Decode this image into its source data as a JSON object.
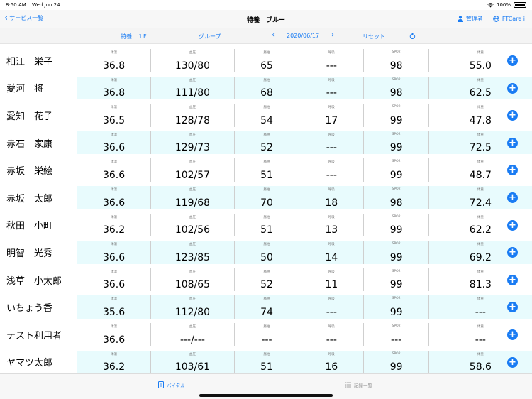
{
  "status": {
    "time": "8:50 AM",
    "date": "Wed Jun 24",
    "battery": "100%"
  },
  "nav": {
    "back_label": "サービス一覧",
    "title": "特養　ブルー",
    "admin_label": "管理者",
    "app_label": "FTCare i"
  },
  "filter": {
    "floor": "特養　１F",
    "group": "グループ",
    "date": "2020/06/17",
    "reset": "リセット"
  },
  "columns": [
    "体温",
    "血圧",
    "脈拍",
    "呼吸",
    "SPO2",
    "体重"
  ],
  "rows": [
    {
      "name": "相江　栄子",
      "values": [
        "36.8",
        "130/80",
        "65",
        "---",
        "98",
        "55.0"
      ]
    },
    {
      "name": "愛河　将",
      "values": [
        "36.8",
        "111/80",
        "68",
        "---",
        "98",
        "62.5"
      ]
    },
    {
      "name": "愛知　花子",
      "values": [
        "36.5",
        "128/78",
        "54",
        "17",
        "99",
        "47.8"
      ]
    },
    {
      "name": "赤石　家康",
      "values": [
        "36.6",
        "129/73",
        "52",
        "---",
        "99",
        "72.5"
      ]
    },
    {
      "name": "赤坂　栄絵",
      "values": [
        "36.6",
        "102/57",
        "51",
        "---",
        "99",
        "48.7"
      ]
    },
    {
      "name": "赤坂　太郎",
      "values": [
        "36.6",
        "119/68",
        "70",
        "18",
        "98",
        "72.4"
      ]
    },
    {
      "name": "秋田　小町",
      "values": [
        "36.2",
        "102/56",
        "51",
        "13",
        "99",
        "62.2"
      ]
    },
    {
      "name": "明智　光秀",
      "values": [
        "36.6",
        "123/85",
        "50",
        "14",
        "99",
        "69.2"
      ]
    },
    {
      "name": "浅草　小太郎",
      "values": [
        "36.6",
        "108/65",
        "52",
        "11",
        "99",
        "81.3"
      ]
    },
    {
      "name": "いちょう香",
      "values": [
        "35.6",
        "112/80",
        "74",
        "---",
        "99",
        "---"
      ]
    },
    {
      "name": "テスト利用者",
      "values": [
        "36.6",
        "---/---",
        "---",
        "---",
        "---",
        "---"
      ]
    },
    {
      "name": "ヤマツ太郎",
      "values": [
        "36.2",
        "103/61",
        "51",
        "16",
        "99",
        "58.6"
      ]
    }
  ],
  "tabs": {
    "vital": "バイタル",
    "records": "記録一覧"
  },
  "colors": {
    "accent": "#1a7cf3",
    "alt_row": "#e8fbfd"
  }
}
